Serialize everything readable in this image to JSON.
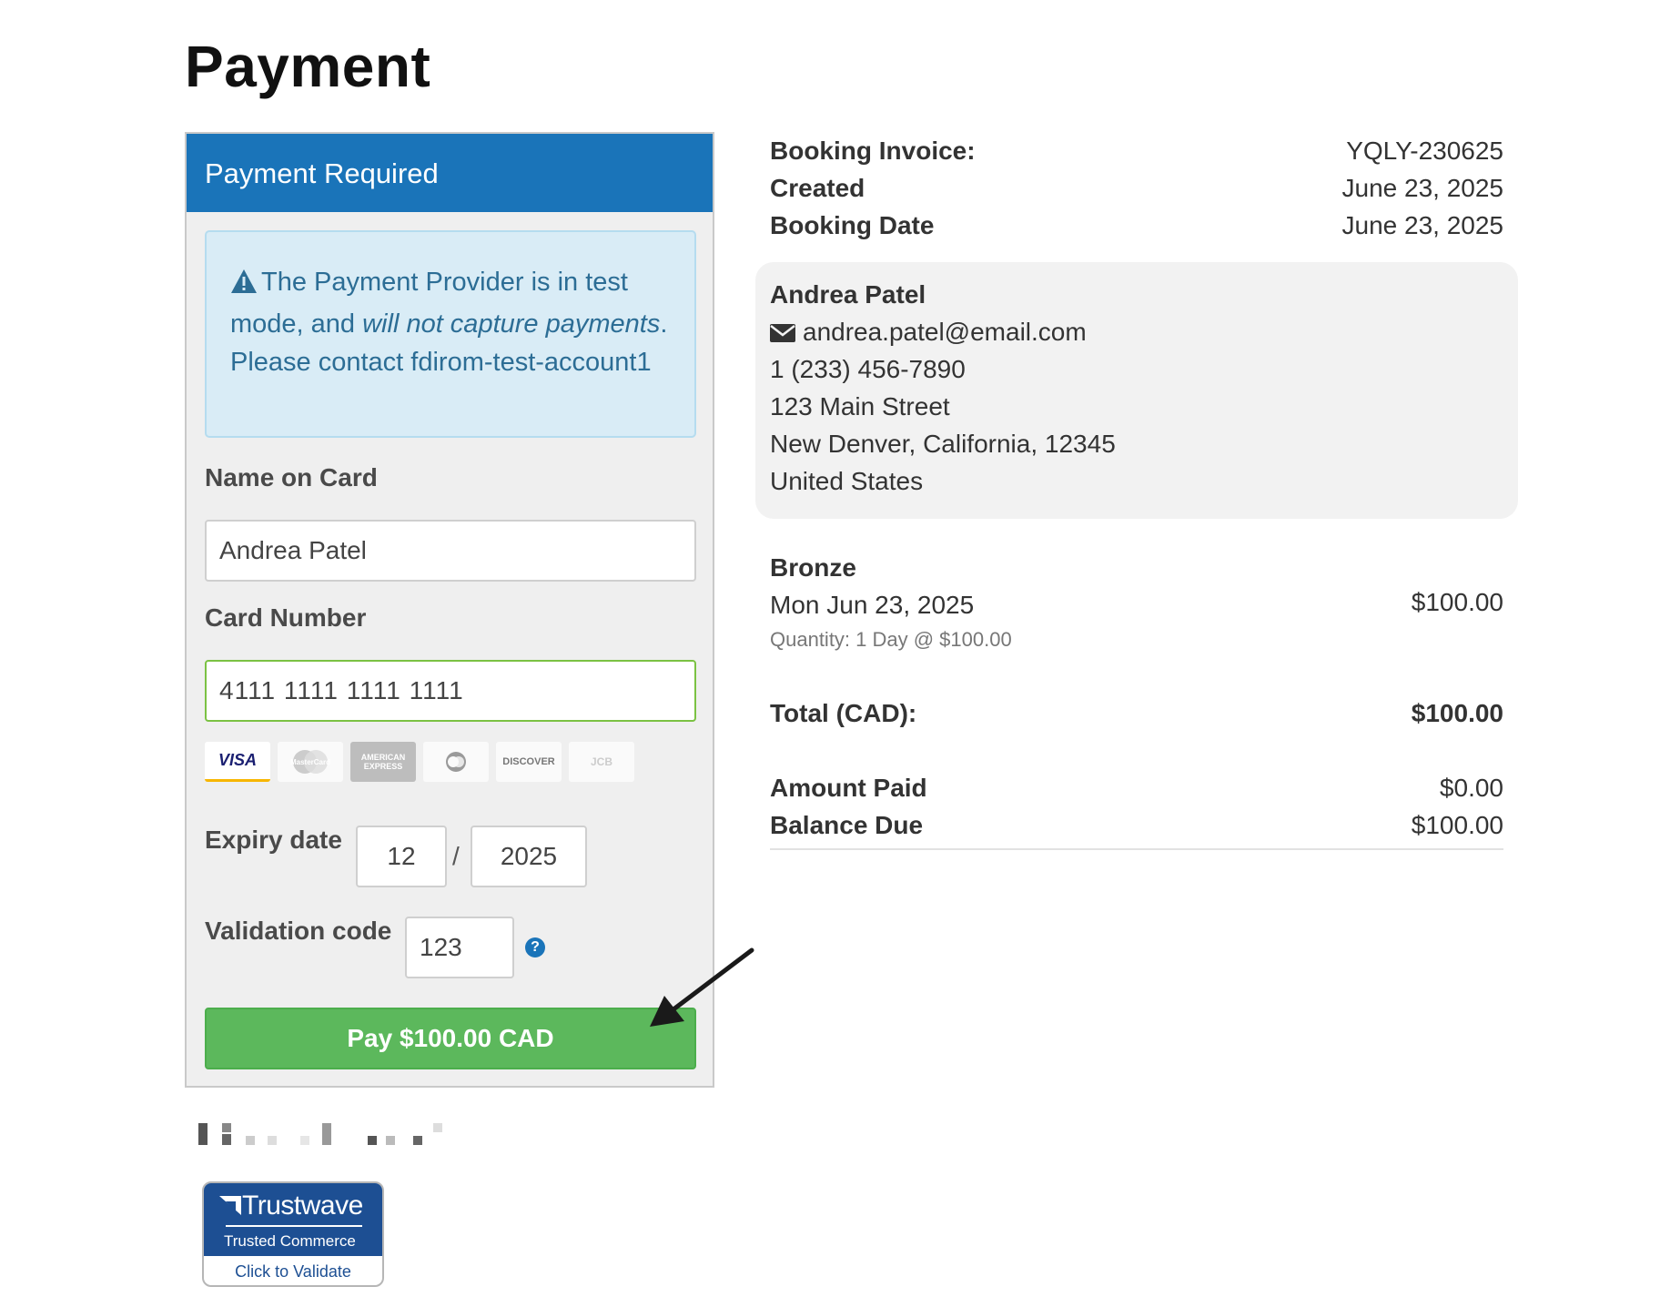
{
  "page": {
    "title": "Payment"
  },
  "payment_panel": {
    "header": "Payment Required",
    "alert": {
      "part1": "The Payment Provider is in test mode, and ",
      "emphasis1": "will not capture payments",
      "part2": ". Please contact fdirom-test-account1"
    },
    "name_label": "Name on Card",
    "name_value": "Andrea Patel",
    "card_label": "Card Number",
    "card_value": "4111 1111 1111 1111",
    "card_brands": [
      "VISA",
      "MasterCard",
      "AMERICAN EXPRESS",
      "Diners",
      "DISCOVER",
      "JCB"
    ],
    "expiry_label": "Expiry date",
    "expiry_month": "12",
    "expiry_separator": "/",
    "expiry_year": "2025",
    "cvv_label": "Validation code",
    "cvv_value": "123",
    "help_icon": "?",
    "pay_button": "Pay $100.00 CAD"
  },
  "badge": {
    "logo": "Trustwave",
    "sub": "Trusted Commerce",
    "cta": "Click to Validate"
  },
  "summary": {
    "invoice_label": "Booking Invoice:",
    "invoice_value": "YQLY-230625",
    "created_label": "Created",
    "created_value": "June 23, 2025",
    "booking_date_label": "Booking Date",
    "booking_date_value": "June 23, 2025",
    "customer": {
      "name": "Andrea Patel",
      "email": "andrea.patel@email.com",
      "phone": "1 (233) 456-7890",
      "street": "123 Main Street",
      "city": "New Denver, California, 12345",
      "country": "United States"
    },
    "item": {
      "name": "Bronze",
      "date": "Mon Jun 23, 2025",
      "quantity": "Quantity: 1 Day @ $100.00",
      "price": "$100.00"
    },
    "total_label": "Total (CAD):",
    "total_value": "$100.00",
    "paid_label": "Amount Paid",
    "paid_value": "$0.00",
    "balance_label": "Balance Due",
    "balance_value": "$100.00"
  },
  "colors": {
    "primary": "#1a74b9",
    "success": "#5cb85c",
    "alert_bg": "#d9ecf6",
    "alert_text": "#2c6d95"
  }
}
